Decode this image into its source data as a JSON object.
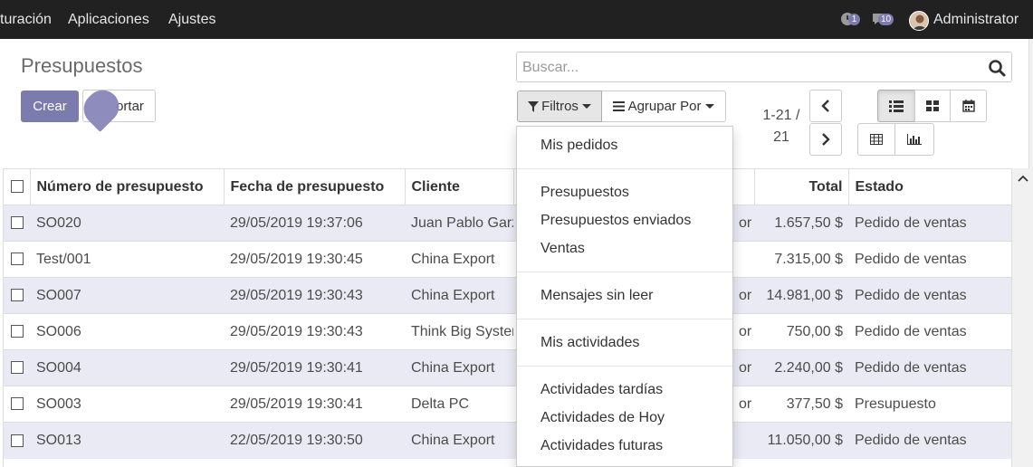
{
  "navbar": {
    "items": [
      "turación",
      "Aplicaciones",
      "Ajustes"
    ],
    "activity_count": "1",
    "messages_count": "10",
    "user": "Administrator"
  },
  "page": {
    "title": "Presupuestos",
    "create_label": "Crear",
    "import_label": "ortar",
    "search_placeholder": "Buscar...",
    "filters_label": "Filtros",
    "group_label": "Agrupar Por",
    "pager_line1": "1-21 /",
    "pager_line2": "21"
  },
  "table": {
    "headers": [
      "Número de presupuesto",
      "Fecha de presupuesto",
      "Cliente",
      "",
      "Total",
      "Estado"
    ],
    "rows": [
      {
        "number": "SO020",
        "date": "29/05/2019 19:37:06",
        "customer": "Juan Pablo Garz",
        "salesperson": "or",
        "total": "1.657,50 $",
        "status": "Pedido de ventas"
      },
      {
        "number": "Test/001",
        "date": "29/05/2019 19:30:45",
        "customer": "China Export",
        "salesperson": "",
        "total": "7.315,00 $",
        "status": "Pedido de ventas"
      },
      {
        "number": "SO007",
        "date": "29/05/2019 19:30:43",
        "customer": "China Export",
        "salesperson": "or",
        "total": "14.981,00 $",
        "status": "Pedido de ventas"
      },
      {
        "number": "SO006",
        "date": "29/05/2019 19:30:43",
        "customer": "Think Big Syster",
        "salesperson": "or",
        "total": "750,00 $",
        "status": "Pedido de ventas"
      },
      {
        "number": "SO004",
        "date": "29/05/2019 19:30:41",
        "customer": "China Export",
        "salesperson": "or",
        "total": "2.240,00 $",
        "status": "Pedido de ventas"
      },
      {
        "number": "SO003",
        "date": "29/05/2019 19:30:41",
        "customer": "Delta PC",
        "salesperson": "or",
        "total": "377,50 $",
        "status": "Presupuesto"
      },
      {
        "number": "SO013",
        "date": "22/05/2019 19:30:50",
        "customer": "China Export",
        "salesperson": "",
        "total": "11.050,00 $",
        "status": "Pedido de ventas"
      }
    ]
  },
  "filters_menu": {
    "groups": [
      [
        "Mis pedidos"
      ],
      [
        "Presupuestos",
        "Presupuestos enviados",
        "Ventas"
      ],
      [
        "Mensajes sin leer"
      ],
      [
        "Mis actividades"
      ],
      [
        "Actividades tardías",
        "Actividades de Hoy",
        "Actividades futuras"
      ]
    ]
  },
  "colors": {
    "navbar_bg": "#212121",
    "primary": "#7c7bad",
    "row_stripe": "#eaeaf4"
  }
}
